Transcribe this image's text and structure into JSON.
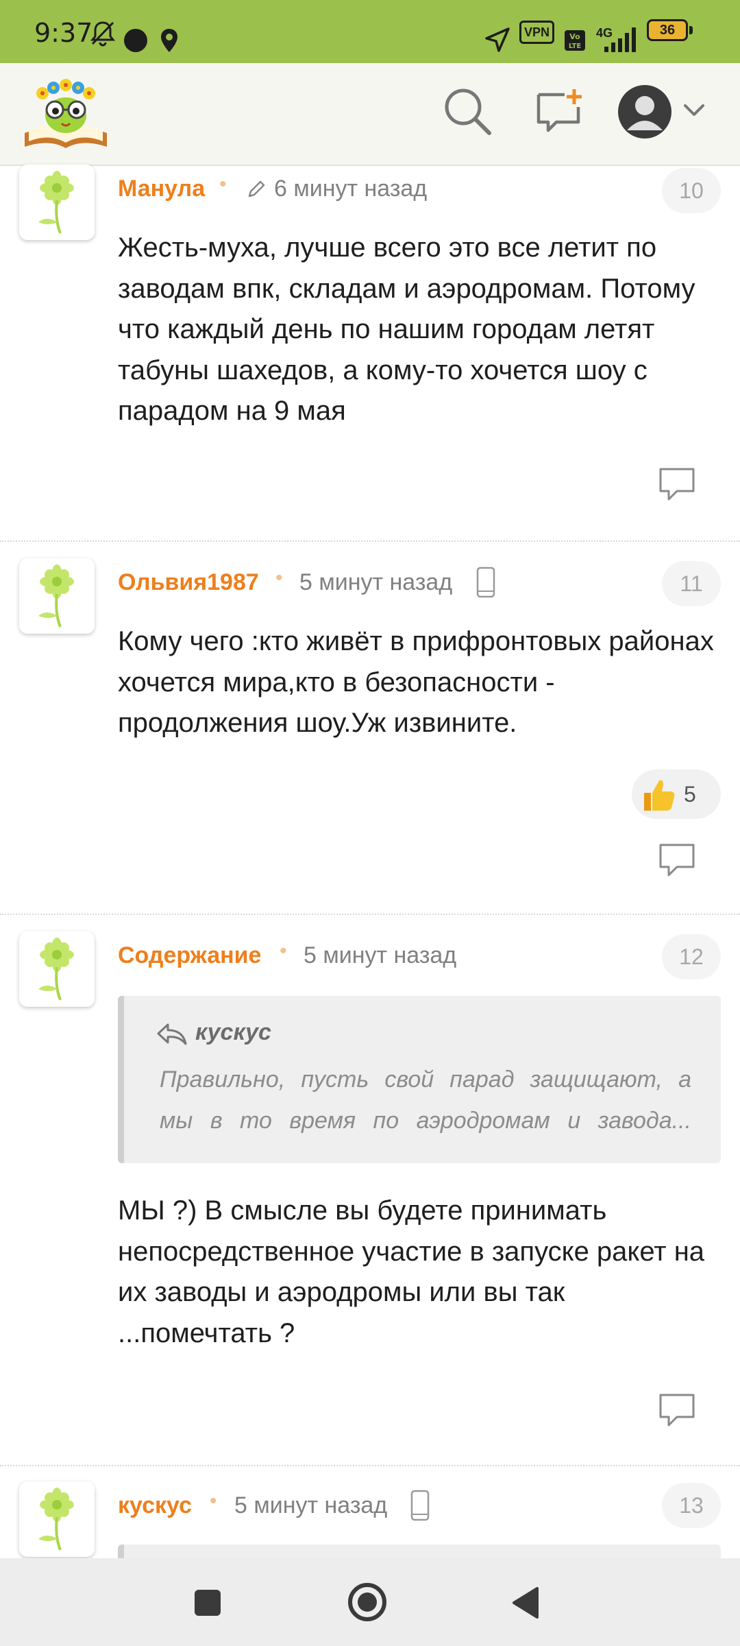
{
  "status_bar": {
    "time": "9:37",
    "vpn": "VPN",
    "network": "4G",
    "volte": "Vo LTE",
    "battery": "36",
    "icons": [
      "bell-off-icon",
      "dot-icon",
      "location-pin-icon",
      "navigation-arrow-icon",
      "signal-icon"
    ]
  },
  "header": {
    "logo": "owl-book-logo",
    "actions": [
      "search-icon",
      "new-message-icon",
      "account-avatar-icon",
      "chevron-down-icon"
    ]
  },
  "comments": [
    {
      "author": "Манула",
      "time": "6 минут назад",
      "edited": true,
      "number": "10",
      "text": "Жесть-муха, лучше всего это все летит по заводам впк, складам и аэродромам. Потому что каждый день по нашим городам летят табуны шахедов, а кому-то хочется шоу с парадом на 9 мая"
    },
    {
      "author": "Ольвия1987",
      "time": "5 минут назад",
      "mobile": true,
      "number": "11",
      "text": "Кому чего :кто живёт в прифронтовых районах хочется мира,кто в безопасности - продолжения шоу.Уж извините.",
      "likes": "5"
    },
    {
      "author": "Содержание",
      "time": "5 минут назад",
      "number": "12",
      "quote": {
        "author": "кускус",
        "text_line1": "Правильно, пусть свой парад защищают, а",
        "text_line2": "мы в то время по аэродромам и завода..."
      },
      "text": "МЫ ?) В смысле вы будете принимать непосредственное участие в запуске ракет на их заводы и аэродромы или вы так ...помечтать ?"
    },
    {
      "author": "кускус",
      "time": "5 минут назад",
      "mobile": true,
      "number": "13"
    }
  ],
  "nav_bar": {
    "buttons": [
      "recents-square-icon",
      "home-circle-icon",
      "back-triangle-icon"
    ]
  },
  "colors": {
    "status_bar": "#9cc04c",
    "author": "#ee7f1c",
    "header_bg": "#f6f6f1"
  }
}
